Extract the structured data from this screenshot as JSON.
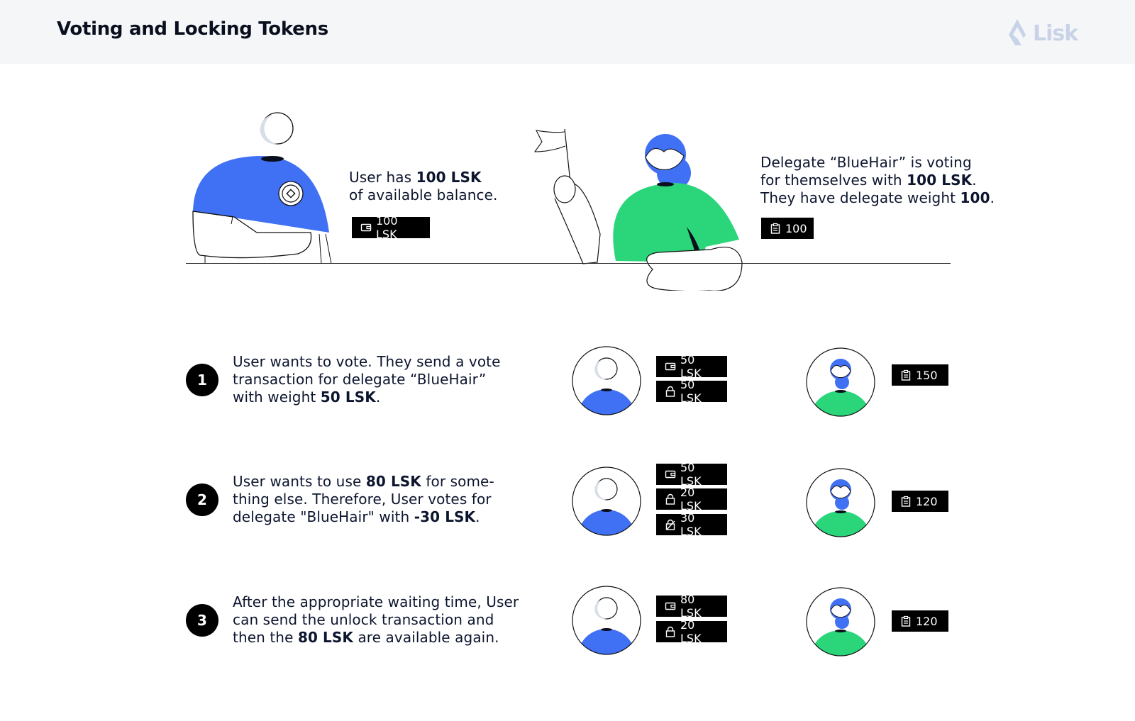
{
  "header": {
    "title": "Voting and Locking Tokens",
    "logo_text": "Lisk"
  },
  "intro": {
    "user": {
      "desc_pre": "User has ",
      "desc_bold": "100 LSK",
      "desc_post": "of available balance.",
      "balance_tag": "100 LSK",
      "balance_icon": "wallet-icon"
    },
    "delegate": {
      "line1": "Delegate “BlueHair” is voting",
      "line2_pre": "for themselves with ",
      "line2_bold": "100 LSK",
      "line2_post": ".",
      "line3_pre": "They have delegate weight ",
      "line3_bold": "100",
      "line3_post": ".",
      "weight_tag": "100",
      "weight_icon": "clipboard-icon"
    }
  },
  "steps": [
    {
      "number": "1",
      "line1": "User wants to vote. They send a vote",
      "line2": "transaction for delegate “BlueHair”",
      "line3_pre": "with weight ",
      "line3_bold": "50 LSK",
      "line3_post": ".",
      "user_tags": [
        {
          "icon": "wallet-icon",
          "label": "50 LSK"
        },
        {
          "icon": "lock-icon",
          "label": "50 LSK"
        }
      ],
      "delegate_weight": "150"
    },
    {
      "number": "2",
      "line1_pre": "User wants to use ",
      "line1_bold": "80 LSK",
      "line1_post": " for some-",
      "line2": "thing else. Therefore, User votes for",
      "line3_pre": "delegate \"BlueHair\" with ",
      "line3_bold": "-30 LSK",
      "line3_post": ".",
      "user_tags": [
        {
          "icon": "wallet-icon",
          "label": "50 LSK"
        },
        {
          "icon": "lock-icon",
          "label": "20 LSK"
        },
        {
          "icon": "unlocking-icon",
          "label": "30 LSK"
        }
      ],
      "delegate_weight": "120"
    },
    {
      "number": "3",
      "line1": "After the appropriate waiting time, User",
      "line2": "can send the unlock transaction and",
      "line3_pre": "then the ",
      "line3_bold": "80 LSK",
      "line3_post": " are available again.",
      "user_tags": [
        {
          "icon": "wallet-icon",
          "label": "80 LSK"
        },
        {
          "icon": "lock-icon",
          "label": "20 LSK"
        }
      ],
      "delegate_weight": "120"
    }
  ],
  "colors": {
    "user_blue": "#4070f4",
    "delegate_green": "#2bd67b",
    "tag_bg": "#000000",
    "header_bg": "#f5f6f8",
    "logo": "#c9d3e8"
  }
}
